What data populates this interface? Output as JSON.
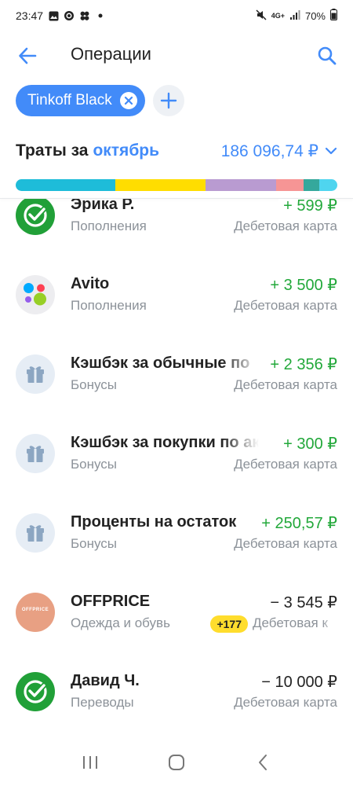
{
  "status_bar": {
    "time": "23:47",
    "battery": "70%",
    "network": "4G+"
  },
  "header": {
    "title": "Операции",
    "back_icon": "arrow-left-icon",
    "search_icon": "search-icon"
  },
  "filters": {
    "chip_label": "Tinkoff Black",
    "add_icon": "plus-icon"
  },
  "spending": {
    "label": "Траты за",
    "month": "октябрь",
    "total": "186 096,74 ₽",
    "segments": [
      {
        "color": "#1ebcd9",
        "share": 0.31
      },
      {
        "color": "#ffdd00",
        "share": 0.28
      },
      {
        "color": "#b99bd1",
        "share": 0.22
      },
      {
        "color": "#f69595",
        "share": 0.085
      },
      {
        "color": "#35a89c",
        "share": 0.05
      },
      {
        "color": "#4fd5ef",
        "share": 0.055
      }
    ]
  },
  "operations": [
    {
      "name": "Эрика Р.",
      "category": "Пополнения",
      "amount": "+ 599 ₽",
      "type": "income",
      "account": "Дебетовая карта",
      "icon": "sber-check-icon"
    },
    {
      "name": "Avito",
      "category": "Пополнения",
      "amount": "+ 3 500 ₽",
      "type": "income",
      "account": "Дебетовая карта",
      "icon": "avito-logo-icon"
    },
    {
      "name": "Кэшбэк за обычные по",
      "category": "Бонусы",
      "amount": "+ 2 356 ₽",
      "type": "income",
      "account": "Дебетовая карта",
      "icon": "gift-icon"
    },
    {
      "name": "Кэшбэк за покупки по ак",
      "category": "Бонусы",
      "amount": "+ 300 ₽",
      "type": "income",
      "account": "Дебетовая карта",
      "icon": "gift-icon"
    },
    {
      "name": "Проценты на остаток",
      "category": "Бонусы",
      "amount": "+ 250,57 ₽",
      "type": "income",
      "account": "Дебетовая карта",
      "icon": "gift-icon"
    },
    {
      "name": "OFFPRICE",
      "category": "Одежда и обувь",
      "amount": "− 3 545 ₽",
      "type": "expense",
      "account": "Дебетовая к",
      "icon": "offprice-logo-icon",
      "logo_text": "OFFPRICE",
      "cashback": "+177"
    },
    {
      "name": "Давид Ч.",
      "category": "Переводы",
      "amount": "− 10 000 ₽",
      "type": "expense",
      "account": "Дебетовая карта",
      "icon": "sber-check-icon"
    }
  ],
  "colors": {
    "accent": "#428bf9",
    "income": "#22a83a",
    "sber_green": "#21a038",
    "badge_yellow": "#ffdd2d"
  }
}
